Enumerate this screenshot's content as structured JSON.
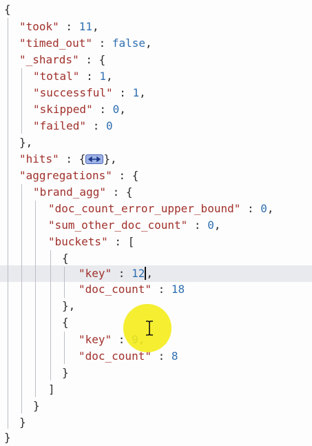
{
  "lines": [
    {
      "open": "{"
    },
    {
      "key": "\"took\"",
      "sep": " : ",
      "num": "11",
      "tail": ","
    },
    {
      "key": "\"timed_out\"",
      "sep": " : ",
      "bool": "false",
      "tail": ","
    },
    {
      "key": "\"_shards\"",
      "sep": " : ",
      "open": "{"
    },
    {
      "key": "\"total\"",
      "sep": " : ",
      "num": "1",
      "tail": ","
    },
    {
      "key": "\"successful\"",
      "sep": " : ",
      "num": "1",
      "tail": ","
    },
    {
      "key": "\"skipped\"",
      "sep": " : ",
      "num": "0",
      "tail": ","
    },
    {
      "key": "\"failed\"",
      "sep": " : ",
      "num": "0"
    },
    {
      "close": "},"
    },
    {
      "key": "\"hits\"",
      "sep": " : ",
      "open": "{",
      "close": "},"
    },
    {
      "key": "\"aggregations\"",
      "sep": " : ",
      "open": "{"
    },
    {
      "key": "\"brand_agg\"",
      "sep": " : ",
      "open": "{"
    },
    {
      "key": "\"doc_count_error_upper_bound\"",
      "sep": " : ",
      "num": "0",
      "tail": ","
    },
    {
      "key": "\"sum_other_doc_count\"",
      "sep": " : ",
      "num": "0",
      "tail": ","
    },
    {
      "key": "\"buckets\"",
      "sep": " : ",
      "open": "["
    },
    {
      "open": "{"
    },
    {
      "key": "\"key\"",
      "sep": " : ",
      "num": "12",
      "tail": ","
    },
    {
      "key": "\"doc_count\"",
      "sep": " : ",
      "num": "18"
    },
    {
      "close": "},"
    },
    {
      "open": "{"
    },
    {
      "key": "\"key\"",
      "sep": " : ",
      "num": "9",
      "tail": ","
    },
    {
      "key": "\"doc_count\"",
      "sep": " : ",
      "num": "8"
    },
    {
      "close": "}"
    },
    {
      "close": "]"
    },
    {
      "close": "}"
    },
    {
      "close": "}"
    },
    {
      "close": "}"
    }
  ],
  "colors": {
    "key": "#a0312c",
    "number": "#2f6fb0",
    "punctuation": "#2c2c2c",
    "active_line": "#e8eaee",
    "cursor_highlight": "#f4ec15",
    "fold_widget": "#9fb4e6"
  },
  "icons": {
    "fold_widget": "collapsed-object-icon",
    "mouse_cursor": "text-ibeam-cursor-icon"
  }
}
